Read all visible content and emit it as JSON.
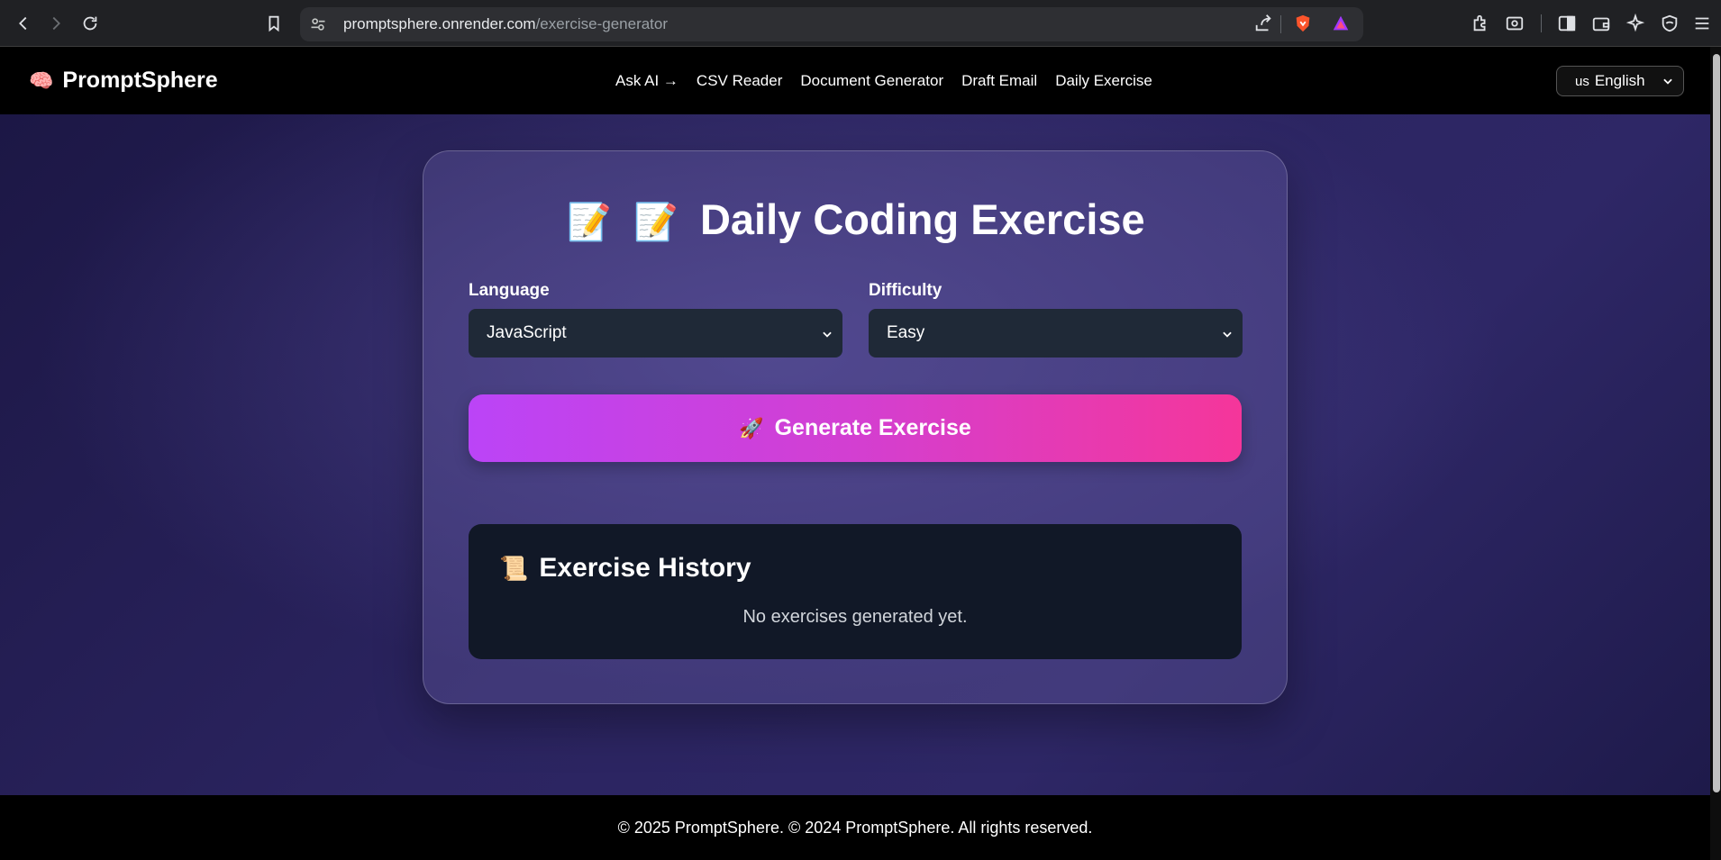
{
  "browser": {
    "url_host": "promptsphere.onrender.com",
    "url_path": "/exercise-generator"
  },
  "header": {
    "logo_text": "PromptSphere",
    "logo_icon": "brain-icon",
    "nav": [
      {
        "label": "Ask AI →"
      },
      {
        "label": "CSV Reader"
      },
      {
        "label": "Document Generator"
      },
      {
        "label": "Draft Email"
      },
      {
        "label": "Daily Exercise"
      }
    ],
    "language": {
      "flag": "us",
      "label": "English"
    }
  },
  "card": {
    "title_emoji_1": "📝",
    "title_emoji_2": "📝",
    "title": "Daily Coding Exercise",
    "language_label": "Language",
    "language_value": "JavaScript",
    "difficulty_label": "Difficulty",
    "difficulty_value": "Easy",
    "generate_icon": "🚀",
    "generate_label": "Generate Exercise"
  },
  "history": {
    "icon": "📜",
    "title": "Exercise History",
    "empty_text": "No exercises generated yet."
  },
  "footer": {
    "text": "© 2025 PromptSphere. © 2024 PromptSphere. All rights reserved."
  },
  "colors": {
    "button_gradient_start": "#bb44f7",
    "button_gradient_end": "#f5369a",
    "select_bg": "#1f2937",
    "history_bg": "#111827"
  }
}
